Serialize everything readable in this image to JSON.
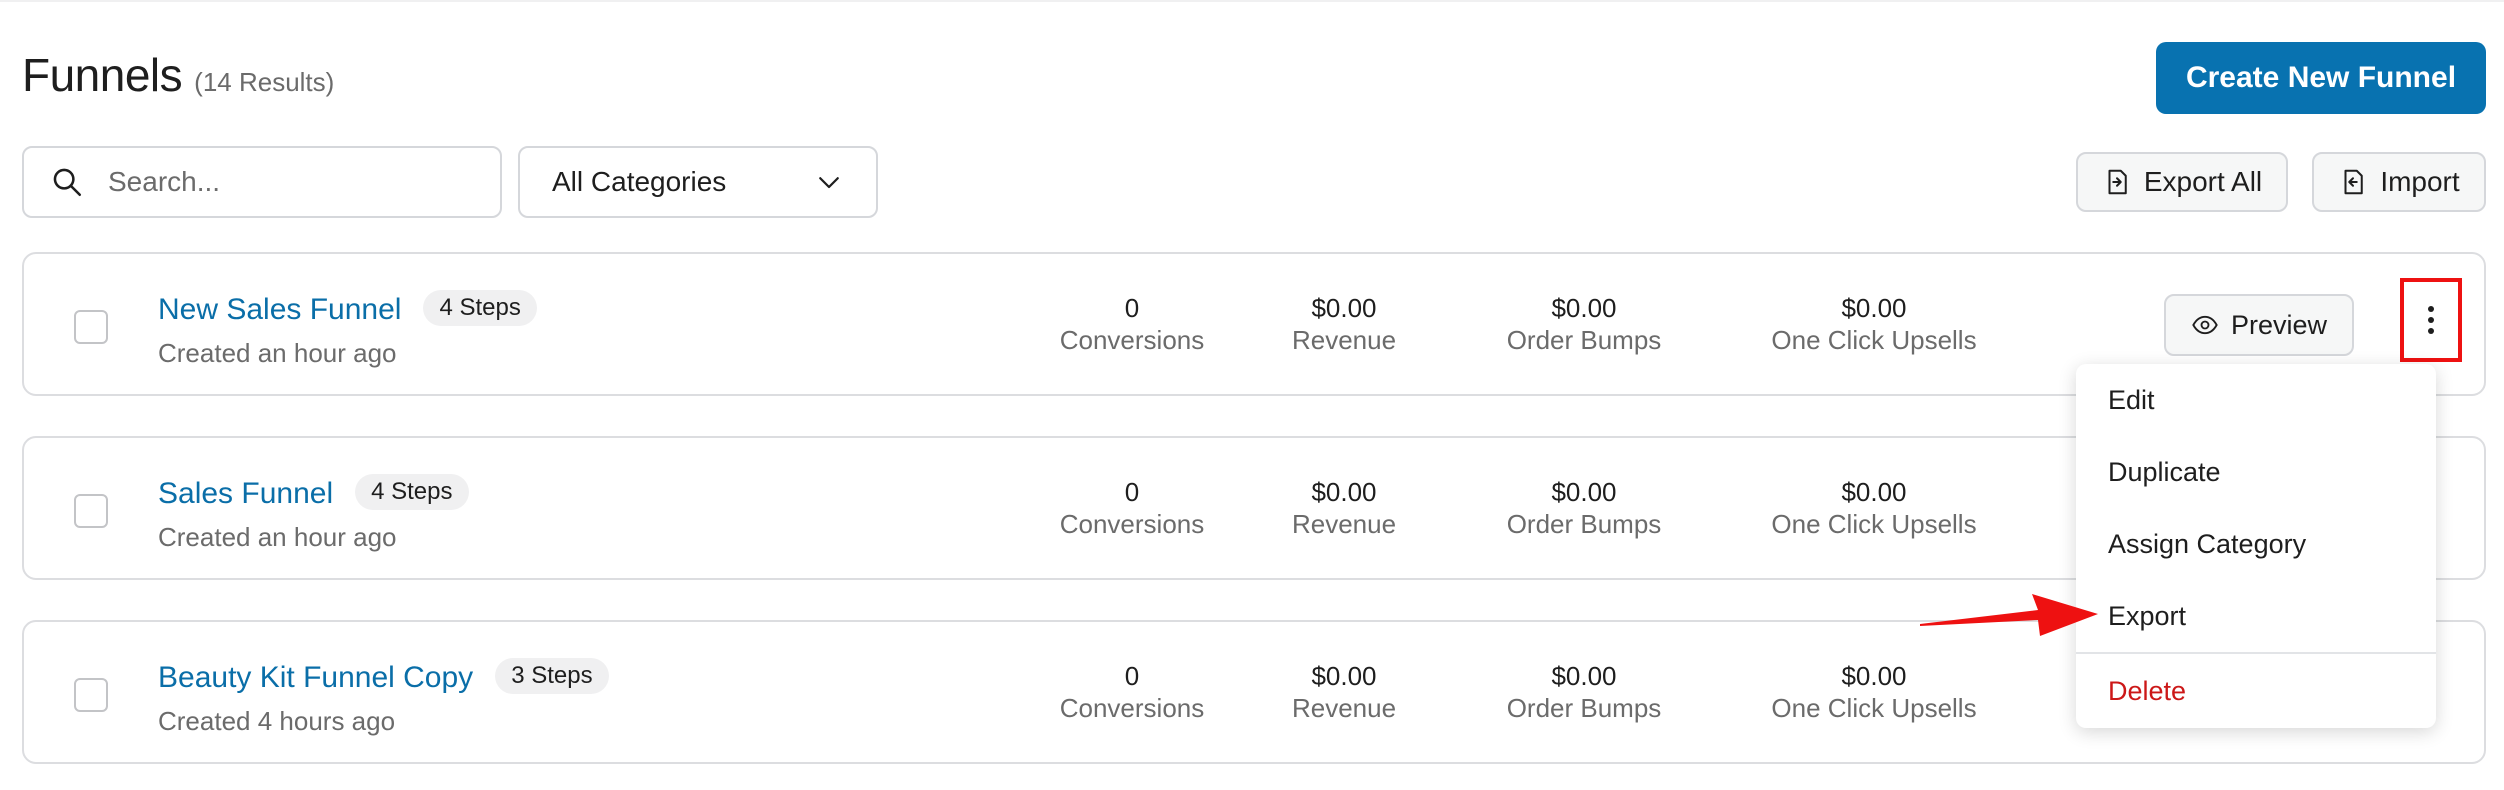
{
  "header": {
    "title": "Funnels",
    "results": "(14 Results)",
    "create_label": "Create New Funnel"
  },
  "toolbar": {
    "search_placeholder": "Search...",
    "category_selected": "All Categories",
    "export_all_label": "Export All",
    "import_label": "Import"
  },
  "funnels": [
    {
      "name": "New Sales Funnel",
      "steps": "4 Steps",
      "created": "Created an hour ago",
      "conversions": "0",
      "revenue": "$0.00",
      "order_bumps": "$0.00",
      "upsells": "$0.00"
    },
    {
      "name": "Sales Funnel",
      "steps": "4 Steps",
      "created": "Created an hour ago",
      "conversions": "0",
      "revenue": "$0.00",
      "order_bumps": "$0.00",
      "upsells": "$0.00"
    },
    {
      "name": "Beauty Kit Funnel Copy",
      "steps": "3 Steps",
      "created": "Created 4 hours ago",
      "conversions": "0",
      "revenue": "$0.00",
      "order_bumps": "$0.00",
      "upsells": "$0.00"
    }
  ],
  "stat_labels": {
    "conversions": "Conversions",
    "revenue": "Revenue",
    "order_bumps": "Order Bumps",
    "upsells": "One Click Upsells"
  },
  "row_actions": {
    "preview_label": "Preview"
  },
  "menu": {
    "items": [
      "Edit",
      "Duplicate",
      "Assign Category",
      "Export"
    ],
    "delete_label": "Delete"
  },
  "icons": {
    "search": "search-icon",
    "dropdown": "chevron-down-icon",
    "export": "export-file-icon",
    "import": "import-file-icon",
    "preview": "eye-icon",
    "more": "vertical-ellipsis-icon",
    "annotation": "red-arrow-icon"
  },
  "colors": {
    "primary": "#0872b0",
    "link": "#0a6ea8",
    "delete": "#cc1818",
    "highlight": "#ee1111"
  }
}
